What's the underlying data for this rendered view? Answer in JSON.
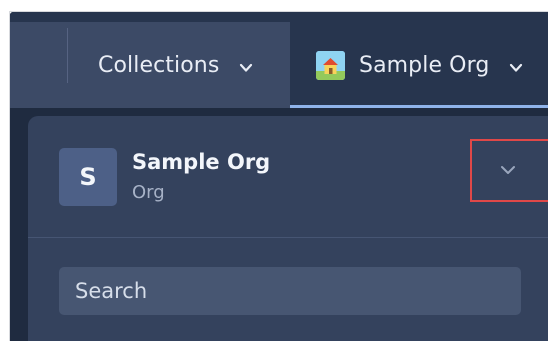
{
  "topbar": {
    "collections_label": "Collections",
    "org_label": "Sample Org"
  },
  "panel": {
    "org_initial": "S",
    "org_name": "Sample Org",
    "org_type": "Org",
    "search_placeholder": "Search"
  },
  "colors": {
    "accent_underline": "#8fb3ea",
    "highlight_box": "#e04848"
  },
  "icons": {
    "collections_chevron": "chevron-down-icon",
    "org_chevron": "chevron-down-icon",
    "org_logo": "house-icon",
    "collapse_chevron": "chevron-down-icon"
  }
}
